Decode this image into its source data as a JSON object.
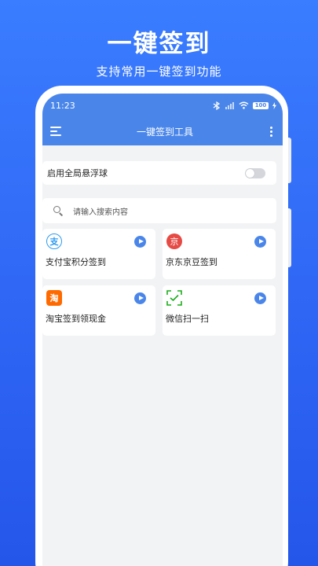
{
  "promo": {
    "title": "一键签到",
    "subtitle": "支持常用一键签到功能"
  },
  "status_bar": {
    "time": "11:23",
    "battery": "100"
  },
  "toolbar": {
    "title": "一键签到工具"
  },
  "settings": {
    "float_ball_label": "启用全局悬浮球",
    "float_ball_enabled": false
  },
  "search": {
    "placeholder": "请输入搜索内容"
  },
  "tiles": [
    {
      "label": "支付宝积分签到",
      "icon": "alipay-icon",
      "glyph": "支"
    },
    {
      "label": "京东京豆签到",
      "icon": "jd-icon",
      "glyph": "京"
    },
    {
      "label": "淘宝签到领现金",
      "icon": "taobao-icon",
      "glyph": "淘"
    },
    {
      "label": "微信扫一扫",
      "icon": "scan-icon",
      "glyph": ""
    }
  ],
  "colors": {
    "accent": "#4a86ea",
    "background_top": "#3a7dff",
    "background_bottom": "#2456ea",
    "card": "#ffffff",
    "screen_bg": "#f2f3f5"
  }
}
